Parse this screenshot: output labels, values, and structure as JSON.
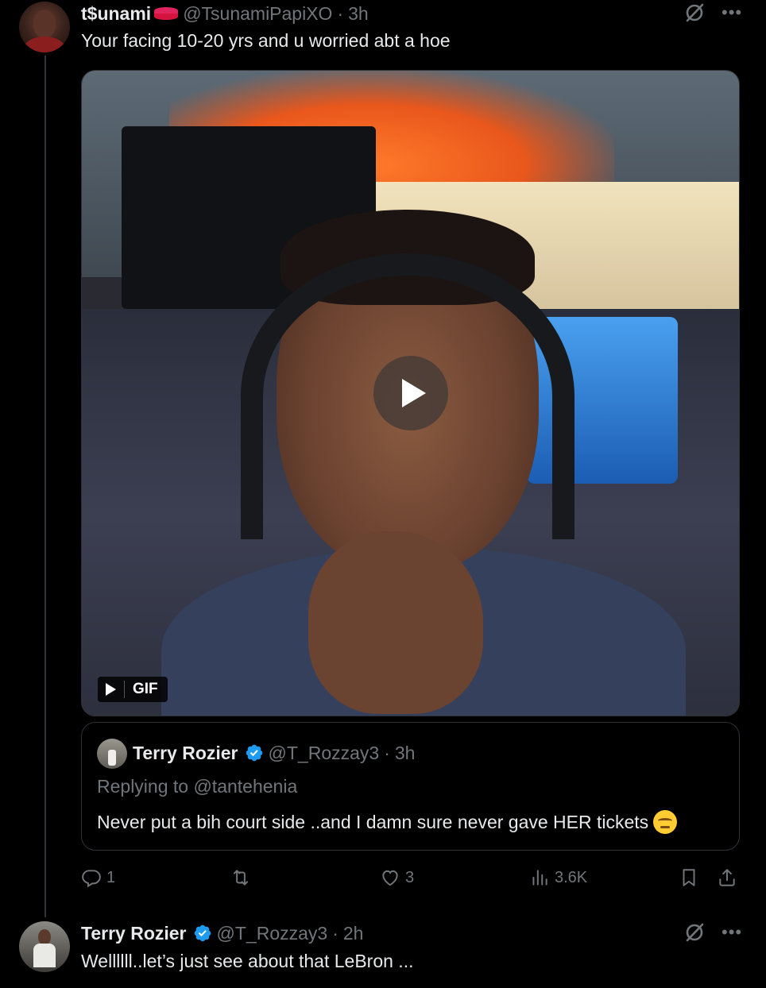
{
  "tweet1": {
    "name": "t$unami",
    "handle": "@TsunamiPapiXO",
    "dot": "·",
    "time": "3h",
    "text": "Your facing 10-20 yrs and u worried abt a hoe",
    "media": {
      "type": "gif",
      "badge": "GIF"
    }
  },
  "quote": {
    "name": "Terry Rozier",
    "handle": "@T_Rozzay3",
    "dot": "·",
    "time": "3h",
    "replying": "Replying to @tantehenia",
    "text": "Never put a bih court side ..and I damn sure never gave HER tickets",
    "emoji": "unamused-face-emoji"
  },
  "actions": {
    "replies": "1",
    "reposts": "",
    "likes": "3",
    "views": "3.6K"
  },
  "tweet2": {
    "name": "Terry Rozier",
    "handle": "@T_Rozzay3",
    "dot": "·",
    "time": "2h",
    "text": "Wellllll..let’s just see about that LeBron ..."
  },
  "colors": {
    "background": "#000000",
    "text": "#e7e9ea",
    "muted": "#71767b",
    "verified": "#1d9bf0",
    "border": "#2f3336"
  }
}
